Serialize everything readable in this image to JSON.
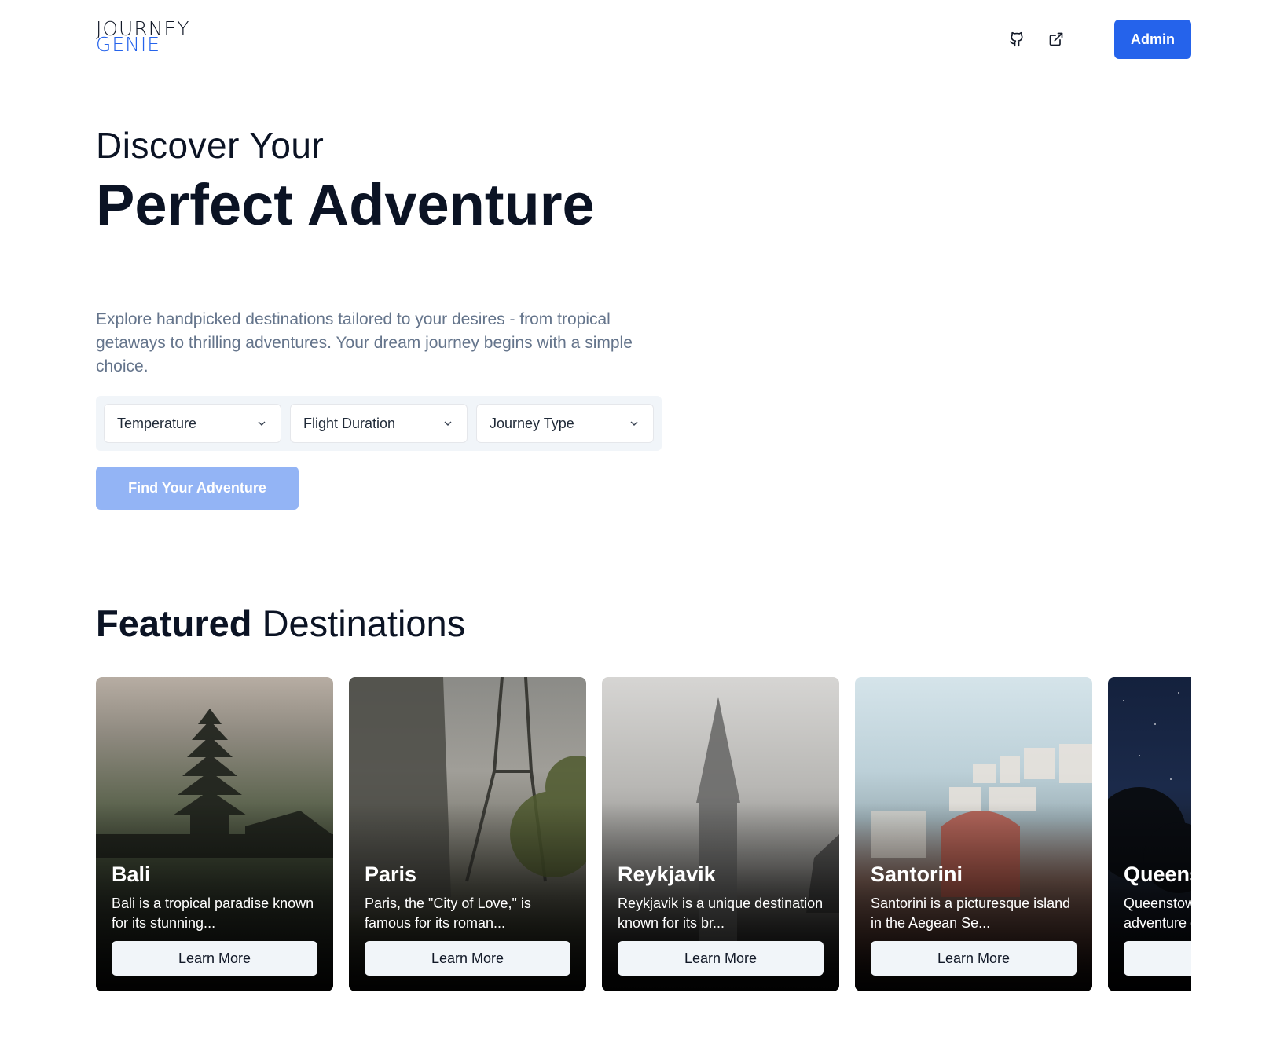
{
  "header": {
    "logo_line1": "JOURNEY",
    "logo_line2": "GENIE",
    "admin_label": "Admin",
    "icons": [
      "github-icon",
      "external-link-icon"
    ],
    "accent_color": "#2563eb"
  },
  "hero": {
    "subtitle": "Discover Your",
    "title": "Perfect Adventure",
    "description": "Explore handpicked destinations tailored to your desires - from tropical getaways to thrilling adventures. Your dream journey begins with a simple choice."
  },
  "filters": [
    {
      "label": "Temperature"
    },
    {
      "label": "Flight Duration"
    },
    {
      "label": "Journey Type"
    }
  ],
  "find_button": "Find Your Adventure",
  "featured": {
    "bold": "Featured",
    "light": "Destinations"
  },
  "destinations": [
    {
      "name": "Bali",
      "desc": "Bali is a tropical paradise known for its stunning...",
      "button": "Learn More"
    },
    {
      "name": "Paris",
      "desc": "Paris, the \"City of Love,\" is famous for its roman...",
      "button": "Learn More"
    },
    {
      "name": "Reykjavik",
      "desc": "Reykjavik is a unique destination known for its br...",
      "button": "Learn More"
    },
    {
      "name": "Santorini",
      "desc": "Santorini is a picturesque island in the Aegean Se...",
      "button": "Learn More"
    },
    {
      "name": "Queenstown",
      "desc": "Queenstown is a haven for adventure enthusiasts...",
      "button": "Learn More"
    }
  ]
}
